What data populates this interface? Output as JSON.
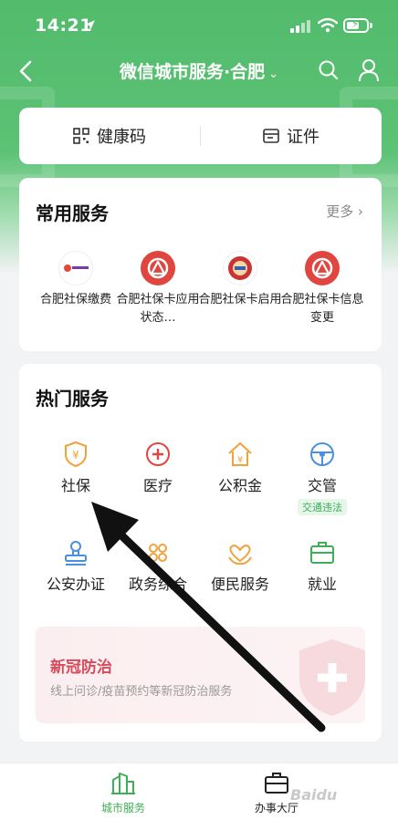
{
  "status_bar": {
    "time": "14:21"
  },
  "nav": {
    "title": "微信城市服务·合肥",
    "chevron": "⌄"
  },
  "quick_actions": [
    {
      "label": "健康码",
      "icon": "qr-code-icon"
    },
    {
      "label": "证件",
      "icon": "id-card-icon"
    }
  ],
  "common_services": {
    "title": "常用服务",
    "more": "更多",
    "items": [
      {
        "label": "合肥社保缴费"
      },
      {
        "label": "合肥社保卡应用状态…"
      },
      {
        "label": "合肥社保卡启用"
      },
      {
        "label": "合肥社保卡信息变更"
      }
    ]
  },
  "hot_services": {
    "title": "热门服务",
    "items": [
      {
        "label": "社保",
        "icon": "social-security-icon"
      },
      {
        "label": "医疗",
        "icon": "medical-icon"
      },
      {
        "label": "公积金",
        "icon": "housing-fund-icon"
      },
      {
        "label": "交管",
        "icon": "traffic-icon",
        "tag": "交通违法"
      },
      {
        "label": "公安办证",
        "icon": "police-stamp-icon"
      },
      {
        "label": "政务综合",
        "icon": "government-icon"
      },
      {
        "label": "便民服务",
        "icon": "convenience-icon"
      },
      {
        "label": "就业",
        "icon": "briefcase-icon"
      }
    ],
    "banner": {
      "title": "新冠防治",
      "subtitle": "线上问诊/疫苗预约等新冠防治服务"
    }
  },
  "tabbar": [
    {
      "label": "城市服务",
      "active": true
    },
    {
      "label": "办事大厅",
      "active": false
    }
  ],
  "colors": {
    "brand_green": "#5cc275",
    "orange": "#f0a23c",
    "red": "#e0463f",
    "blue": "#4a90e2"
  },
  "watermark": "Baidu"
}
